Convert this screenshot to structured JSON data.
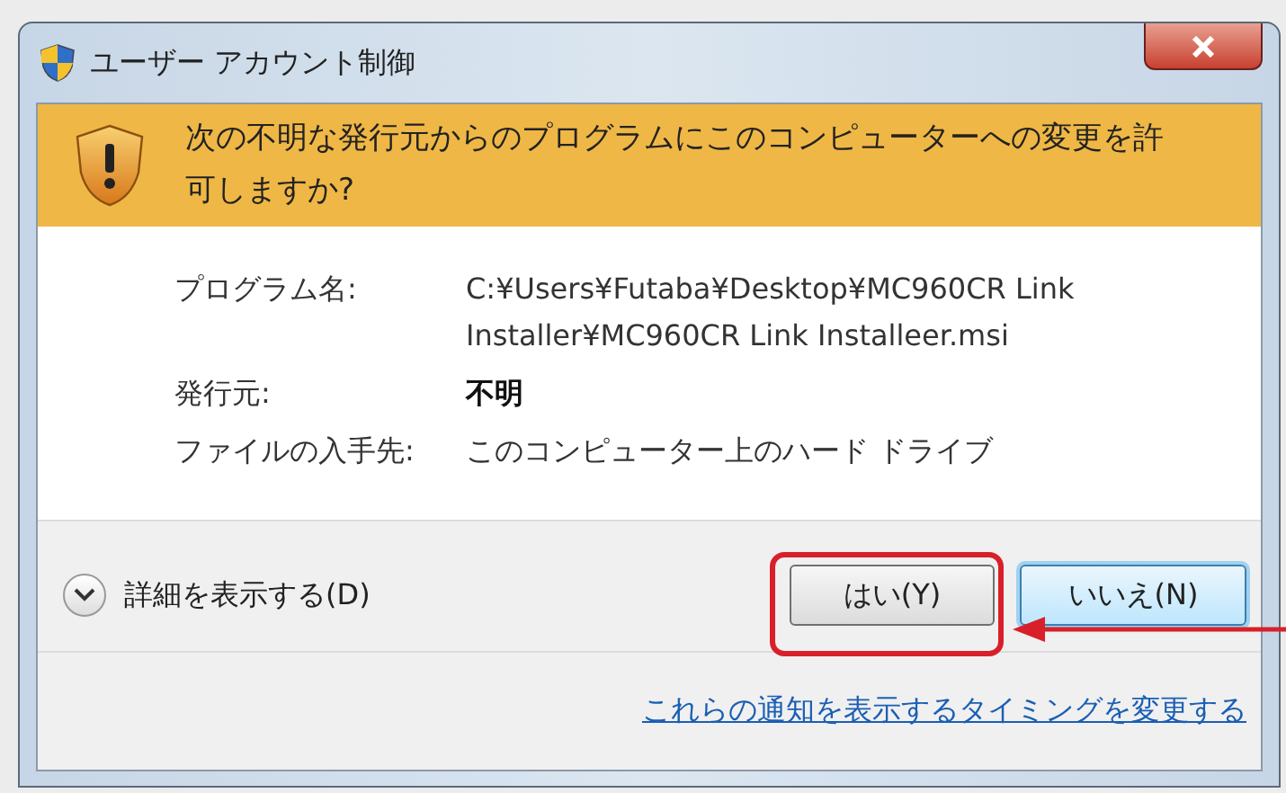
{
  "window": {
    "title": "ユーザー アカウント制御"
  },
  "banner": {
    "message": "次の不明な発行元からのプログラムにこのコンピューターへの変更を許可しますか?"
  },
  "details": [
    {
      "label": "プログラム名:",
      "value": "C:¥Users¥Futaba¥Desktop¥MC960CR Link Installer¥MC960CR Link Installeer.msi",
      "bold": false
    },
    {
      "label": "発行元:",
      "value": "不明",
      "bold": true
    },
    {
      "label": "ファイルの入手先:",
      "value": "このコンピューター上のハード ドライブ",
      "bold": false
    }
  ],
  "show_details": {
    "label": "詳細を表示する(D)",
    "expanded": false
  },
  "buttons": [
    {
      "label": "はい(Y)",
      "default": false
    },
    {
      "label": "いいえ(N)",
      "default": true
    }
  ],
  "link": "これらの通知を表示するタイミングを変更する"
}
